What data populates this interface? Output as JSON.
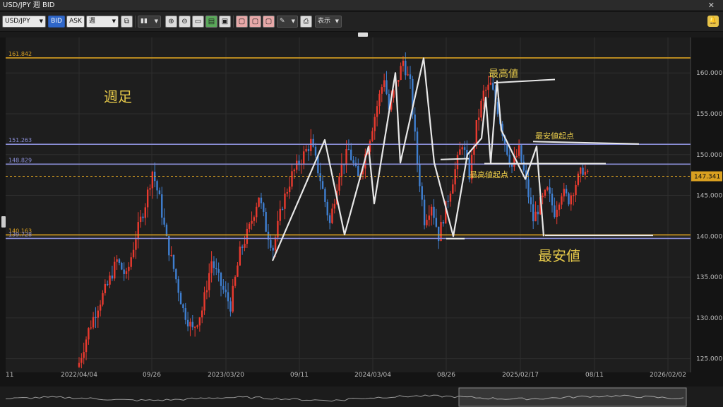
{
  "window": {
    "title": "USD/JPY 週 BID",
    "close_label": "✕"
  },
  "toolbar": {
    "symbol": "USD/JPY",
    "bid": "BID",
    "ask": "ASK",
    "timeframe": "週",
    "display_menu": "表示"
  },
  "annotations": {
    "weekly_label": "週足",
    "highest": "最高値",
    "highest_origin": "最高値起点",
    "lowest_origin": "最安値起点",
    "lowest": "最安値"
  },
  "colors": {
    "bull": "#ea3a2f",
    "bear": "#3f7fd0",
    "gold_line": "#d9a021",
    "purple_line": "#8a8ed6",
    "annotation_text": "#e6c94a",
    "bg": "#1e1e1e",
    "grid": "#2e2e2e"
  },
  "chart_data": {
    "type": "candlestick",
    "y_ticks": [
      "160.000",
      "155.000",
      "150.000",
      "145.000",
      "140.000",
      "135.000",
      "130.000",
      "125.000"
    ],
    "x_ticks": [
      "11",
      "2022/04/04",
      "09/26",
      "2023/03/20",
      "09/11",
      "2024/03/04",
      "08/26",
      "2025/02/17",
      "08/11",
      "2026/02/02"
    ],
    "ylim": [
      123.5,
      164.0
    ],
    "current_price": "147.341",
    "levels": [
      {
        "label": "161.842",
        "value": 161.842,
        "color": "#d9a021"
      },
      {
        "label": "151.263",
        "value": 151.263,
        "color": "#8a8ed6"
      },
      {
        "label": "148.829",
        "value": 148.829,
        "color": "#8a8ed6"
      },
      {
        "label": "140.163",
        "value": 140.163,
        "color": "#d9a021"
      },
      {
        "label": "139.728",
        "value": 139.728,
        "color": "#8a8ed6"
      }
    ],
    "price_anchors": [
      [
        0,
        124.5
      ],
      [
        4,
        128.5
      ],
      [
        8,
        131.5
      ],
      [
        12,
        134.0
      ],
      [
        16,
        137.0
      ],
      [
        20,
        135.0
      ],
      [
        24,
        140.0
      ],
      [
        28,
        144.0
      ],
      [
        31,
        148.0
      ],
      [
        34,
        144.5
      ],
      [
        37,
        139.5
      ],
      [
        40,
        136.0
      ],
      [
        44,
        131.0
      ],
      [
        48,
        128.5
      ],
      [
        52,
        131.0
      ],
      [
        56,
        137.0
      ],
      [
        60,
        134.0
      ],
      [
        64,
        131.5
      ],
      [
        68,
        138.0
      ],
      [
        72,
        141.0
      ],
      [
        76,
        145.0
      ],
      [
        79,
        141.0
      ],
      [
        82,
        138.5
      ],
      [
        86,
        144.0
      ],
      [
        90,
        147.5
      ],
      [
        94,
        149.5
      ],
      [
        98,
        151.5
      ],
      [
        102,
        147.0
      ],
      [
        106,
        141.5
      ],
      [
        110,
        148.0
      ],
      [
        114,
        150.5
      ],
      [
        118,
        147.0
      ],
      [
        122,
        151.0
      ],
      [
        126,
        156.0
      ],
      [
        129,
        159.5
      ],
      [
        131,
        155.5
      ],
      [
        134,
        158.5
      ],
      [
        137,
        161.5
      ],
      [
        140,
        158.5
      ],
      [
        143,
        149.0
      ],
      [
        146,
        142.0
      ],
      [
        149,
        144.0
      ],
      [
        152,
        140.0
      ],
      [
        155,
        143.5
      ],
      [
        158,
        147.0
      ],
      [
        162,
        151.5
      ],
      [
        165,
        147.5
      ],
      [
        168,
        153.5
      ],
      [
        171,
        157.5
      ],
      [
        174,
        158.5
      ],
      [
        177,
        155.5
      ],
      [
        180,
        151.5
      ],
      [
        183,
        148.5
      ],
      [
        186,
        150.5
      ],
      [
        189,
        146.5
      ],
      [
        192,
        142.0
      ],
      [
        195,
        144.0
      ],
      [
        198,
        145.5
      ],
      [
        201,
        143.0
      ],
      [
        204,
        145.5
      ],
      [
        207,
        144.5
      ],
      [
        210,
        146.5
      ],
      [
        213,
        148.2
      ],
      [
        215,
        147.34
      ]
    ]
  }
}
